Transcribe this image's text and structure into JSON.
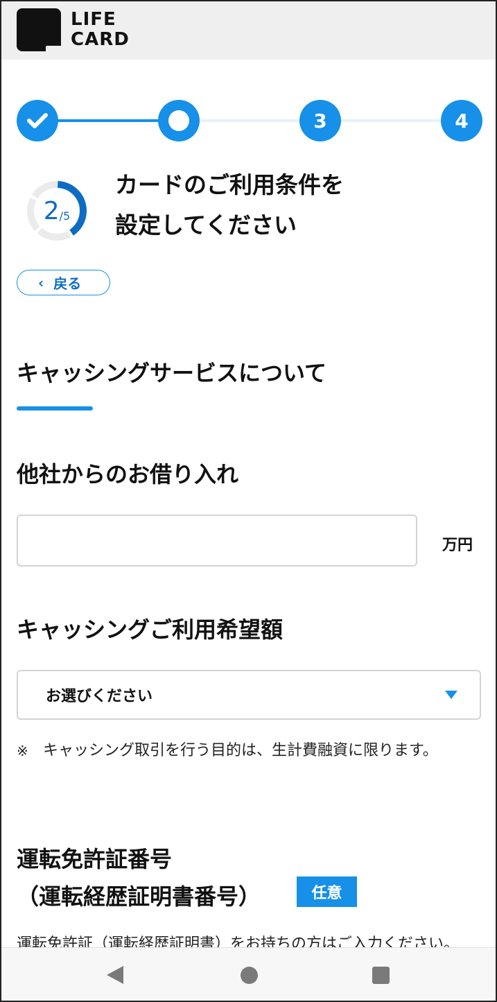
{
  "header": {
    "logo_line1": "LIFE",
    "logo_line2": "CARD"
  },
  "stepper": {
    "current_step": 2,
    "steps": [
      {
        "label": "",
        "state": "done",
        "icon": "check-icon"
      },
      {
        "label": "",
        "state": "current"
      },
      {
        "label": "3",
        "state": "todo"
      },
      {
        "label": "4",
        "state": "todo"
      }
    ]
  },
  "progress": {
    "current": "2",
    "total": "/5",
    "fraction": 0.4
  },
  "page_title": {
    "line1": "カードのご利用条件を",
    "line2": "設定してください"
  },
  "back_button": {
    "label": "戻る",
    "icon": "chevron-left-icon"
  },
  "section": {
    "title": "キャッシングサービスについて"
  },
  "fields": {
    "other_loans": {
      "label": "他社からのお借り入れ",
      "value": "",
      "unit": "万円"
    },
    "cashing_amount": {
      "label": "キャッシングご利用希望額",
      "selected": "お選びください",
      "note_mark": "※",
      "note": "キャッシング取引を行う目的は、生計費融資に限ります。"
    },
    "license": {
      "label_line1": "運転免許証番号",
      "label_line2": "（運転経歴証明書番号）",
      "badge": "任意",
      "description": "運転免許証（運転経歴証明書）をお持ちの方はご入力ください。"
    }
  },
  "colors": {
    "accent": "#1690e8",
    "accent_dark": "#0d6cc4",
    "track": "#e4f2fb",
    "header_bg": "#efefef"
  },
  "navbar": {
    "back_icon": "triangle-back-icon",
    "home_icon": "circle-home-icon",
    "recent_icon": "square-recents-icon"
  }
}
